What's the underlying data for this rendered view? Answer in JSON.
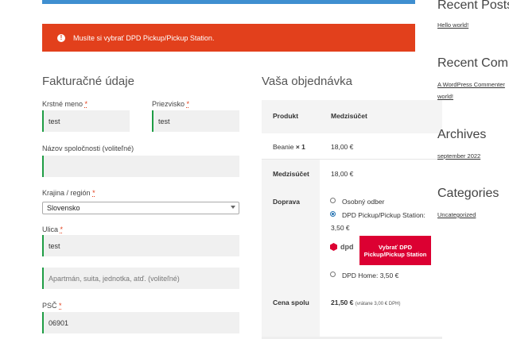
{
  "notice": {
    "icon": "!",
    "text": "Musíte si vybrať DPD Pickup/Pickup Station."
  },
  "billing": {
    "heading": "Fakturačné údaje",
    "first_name": {
      "label": "Krstné meno",
      "value": "test"
    },
    "last_name": {
      "label": "Priezvisko",
      "value": "test"
    },
    "company": {
      "label": "Názov spoločnosti (voliteľné)",
      "value": ""
    },
    "country": {
      "label": "Krajina / región",
      "value": "Slovensko"
    },
    "street": {
      "label": "Ulica",
      "value": "test"
    },
    "street2": {
      "placeholder": "Apartmán, suita, jednotka, atď. (voliteľné)"
    },
    "zip": {
      "label": "PSČ",
      "value": "06901"
    },
    "required_mark": "*"
  },
  "order": {
    "heading": "Vaša objednávka",
    "col_product": "Produkt",
    "col_subtotal": "Medzisúčet",
    "item": {
      "name": "Beanie",
      "qty": "× 1",
      "price": "18,00 €"
    },
    "subtotal_label": "Medzisúčet",
    "subtotal_value": "18,00 €",
    "shipping_label": "Doprava",
    "shipping_options": [
      {
        "label": "Osobný odber",
        "selected": false
      },
      {
        "label": "DPD Pickup/Pickup Station:",
        "price": "3,50 €",
        "selected": true
      },
      {
        "label": "DPD Home: 3,50 €",
        "selected": false
      }
    ],
    "dpd_logo": "dpd",
    "dpd_button": "Vybrať DPD Pickup/Pickup Station",
    "total_label": "Cena spolu",
    "total_value": "21,50 €",
    "total_tax": "(vrátane 3,00 € DPH)"
  },
  "sidebar": {
    "recent_posts": {
      "title": "Recent Posts",
      "links": [
        "Hello world!"
      ]
    },
    "recent_comments": {
      "title": "Recent Comm",
      "author": "A WordPress Commenter",
      "post": "world!"
    },
    "archives": {
      "title": "Archives",
      "links": [
        "september 2022"
      ]
    },
    "categories": {
      "title": "Categories",
      "links": [
        "Uncategorized"
      ]
    }
  },
  "colors": {
    "error": "#e2401c",
    "dpd_red": "#dc0032",
    "valid_green": "#1f9d45",
    "info_blue": "#3f8fd0"
  }
}
